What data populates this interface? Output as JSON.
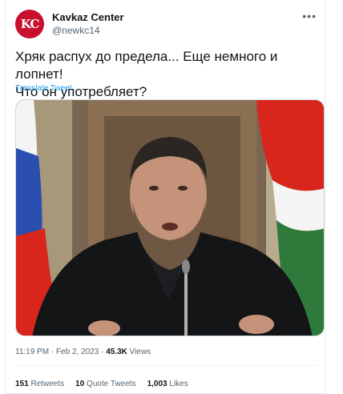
{
  "author": {
    "avatar_text": "KC",
    "display_name": "Kavkaz Center",
    "handle": "@newkc14"
  },
  "more_icon": "more-horizontal-icon",
  "tweet": {
    "text_line1": "Хряк распух до предела... Еще немного и лопнет!",
    "text_line2": "Что он употребляет?",
    "translate_label": "Translate Tweet"
  },
  "meta": {
    "time": "11:19 PM",
    "separator": " · ",
    "date": "Feb 2, 2023",
    "views_count": "45.3K",
    "views_label": " Views"
  },
  "stats": {
    "retweets_count": "151",
    "retweets_label": " Retweets",
    "quotes_count": "10",
    "quotes_label": " Quote Tweets",
    "likes_count": "1,003",
    "likes_label": " Likes"
  },
  "colors": {
    "brand_red": "#c8102e",
    "link_blue": "#1d9bf0"
  }
}
